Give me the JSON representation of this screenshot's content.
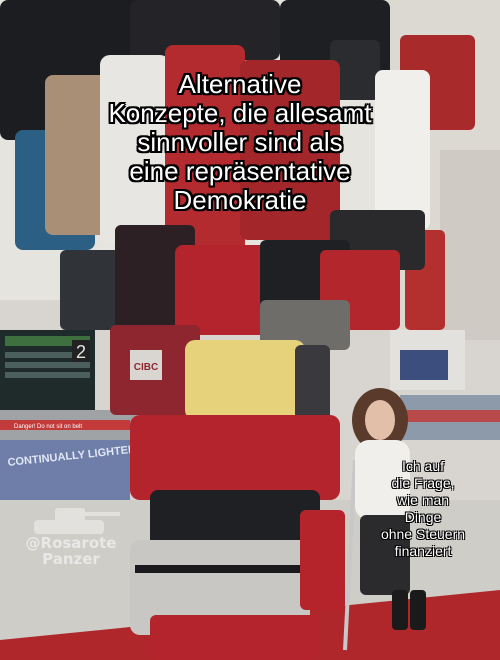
{
  "top_caption": {
    "lines": [
      "Alternative",
      "Konzepte, die allesamt",
      "sinnvoller sind als",
      "eine repräsentative",
      "Demokratie"
    ]
  },
  "side_caption": {
    "lines": [
      "Ich auf",
      "die Frage,",
      "wie man",
      "Dinge",
      "ohne Steuern",
      "finanziert"
    ]
  },
  "watermark": {
    "lines": [
      "@Rosarote",
      "Panzer"
    ]
  },
  "scene": {
    "airport_sign_number": "2",
    "suitcase_brand": "CIBC",
    "carousel_banner": "CONTINUALLY LIGHTER AND STRONGER",
    "carousel_warning": "Danger! Do not sit on belt"
  },
  "colors": {
    "caption_text": "#ffffff",
    "caption_outline": "#000000",
    "suitcase_red": "#b3242c",
    "suitcase_yellow": "#e5d27a",
    "floor_red": "#b0272b"
  }
}
